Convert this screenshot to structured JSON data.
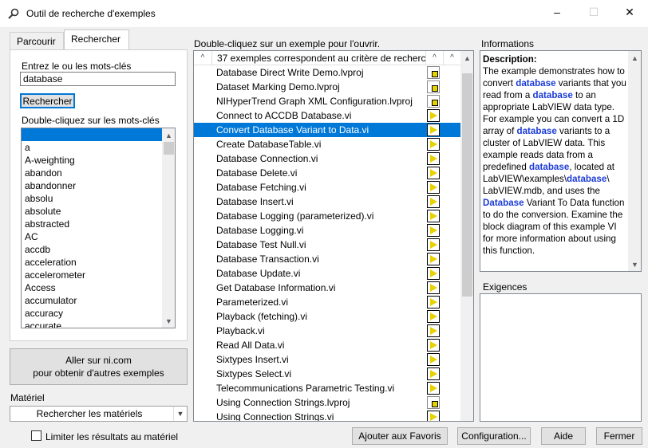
{
  "window": {
    "title": "Outil de recherche d'exemples",
    "icons": [
      "search-app-icon",
      "minimize-icon",
      "maximize-icon",
      "close-icon"
    ]
  },
  "tabs": [
    {
      "label": "Parcourir",
      "active": false
    },
    {
      "label": "Rechercher",
      "active": true
    }
  ],
  "search": {
    "keywords_label": "Entrez le ou les mots-clés",
    "query": "database",
    "search_button": "Rechercher",
    "keyword_list_label": "Double-cliquez sur les mots-clés",
    "keywords": [
      "",
      "a",
      "A-weighting",
      "abandon",
      "abandonner",
      "absolu",
      "absolute",
      "abstracted",
      "AC",
      "accdb",
      "acceleration",
      "accelerometer",
      "Access",
      "accumulator",
      "accuracy",
      "accurate"
    ]
  },
  "ni_button": {
    "line1": "Aller sur ni.com",
    "line2": "pour obtenir d'autres exemples"
  },
  "hardware": {
    "label": "Matériel",
    "select_value": "Rechercher les matériels",
    "limit_label": "Limiter les résultats au matériel",
    "limit_checked": false
  },
  "results": {
    "label": "Double-cliquez sur un exemple pour l'ouvrir.",
    "header_text": "37 exemples correspondent au critère de recherch",
    "items": [
      {
        "name": "Database Direct Write Demo.lvproj",
        "type": "project"
      },
      {
        "name": "Dataset Marking Demo.lvproj",
        "type": "project"
      },
      {
        "name": "NIHyperTrend Graph XML Configuration.lvproj",
        "type": "project"
      },
      {
        "name": "Connect to ACCDB Database.vi",
        "type": "vi"
      },
      {
        "name": "Convert Database Variant to Data.vi",
        "type": "vi",
        "selected": true
      },
      {
        "name": "Create DatabaseTable.vi",
        "type": "vi"
      },
      {
        "name": "Database Connection.vi",
        "type": "vi"
      },
      {
        "name": "Database Delete.vi",
        "type": "vi"
      },
      {
        "name": "Database Fetching.vi",
        "type": "vi"
      },
      {
        "name": "Database Insert.vi",
        "type": "vi"
      },
      {
        "name": "Database Logging (parameterized).vi",
        "type": "vi"
      },
      {
        "name": "Database Logging.vi",
        "type": "vi"
      },
      {
        "name": "Database Test Null.vi",
        "type": "vi"
      },
      {
        "name": "Database Transaction.vi",
        "type": "vi"
      },
      {
        "name": "Database Update.vi",
        "type": "vi"
      },
      {
        "name": "Get Database Information.vi",
        "type": "vi"
      },
      {
        "name": "Parameterized.vi",
        "type": "vi"
      },
      {
        "name": "Playback (fetching).vi",
        "type": "vi"
      },
      {
        "name": "Playback.vi",
        "type": "vi"
      },
      {
        "name": "Read All Data.vi",
        "type": "vi"
      },
      {
        "name": "Sixtypes Insert.vi",
        "type": "vi"
      },
      {
        "name": "Sixtypes Select.vi",
        "type": "vi"
      },
      {
        "name": "Telecommunications Parametric Testing.vi",
        "type": "vi"
      },
      {
        "name": "Using Connection Strings.lvproj",
        "type": "project"
      },
      {
        "name": "Using Connection Strings.vi",
        "type": "vi"
      }
    ]
  },
  "info": {
    "label": "Informations",
    "description_label": "Description:",
    "requirements_label": "Exigences"
  },
  "buttons": {
    "favorites": "Ajouter aux Favoris",
    "configuration": "Configuration...",
    "help": "Aide",
    "close": "Fermer"
  },
  "colors": {
    "selection": "#0078d7",
    "keyword_highlight": "#1c3cd6"
  }
}
